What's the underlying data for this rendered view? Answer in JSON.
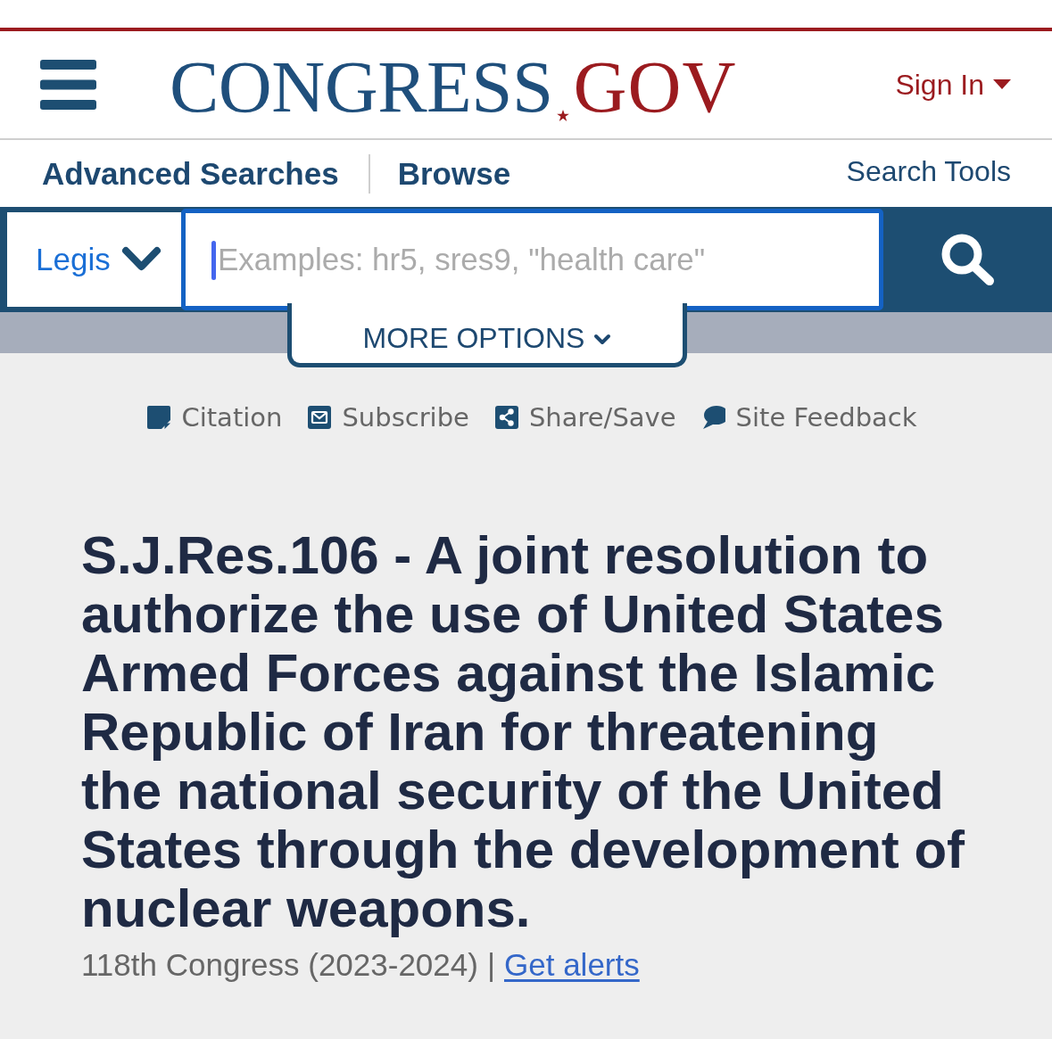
{
  "header": {
    "logo": {
      "part_1": "CONGRESS",
      "part_2": "GOV"
    },
    "sign_in": "Sign In"
  },
  "nav": {
    "links": [
      "Advanced Searches",
      "Browse"
    ],
    "search_tools": "Search Tools"
  },
  "search": {
    "scope": "Legis",
    "placeholder": "Examples: hr5, sres9, \"health care\"",
    "more_options": "MORE OPTIONS"
  },
  "actions": [
    {
      "kind": "citation",
      "label": "Citation"
    },
    {
      "kind": "subscribe",
      "label": "Subscribe"
    },
    {
      "kind": "share",
      "label": "Share/Save"
    },
    {
      "kind": "feedback",
      "label": "Site Feedback"
    }
  ],
  "bill": {
    "title": "S.J.Res.106 - A joint resolution to authorize the use of United States Armed Forces against the Islamic Republic of Iran for threatening the national security of the United States through the development of nuclear weapons.",
    "congress": "118th Congress (2023-2024)",
    "separator": "|",
    "alerts_link": "Get alerts"
  }
}
